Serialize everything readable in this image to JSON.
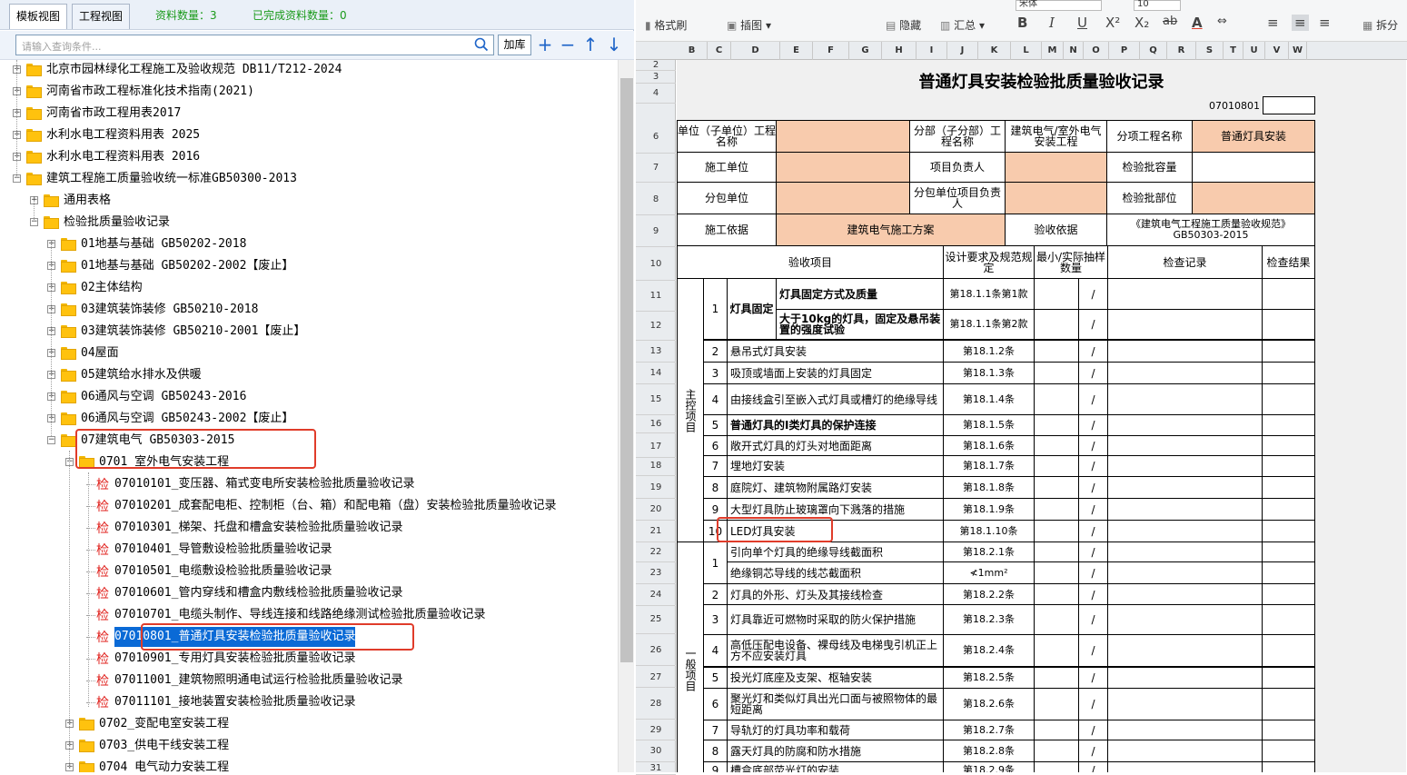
{
  "left_panel": {
    "tabs": [
      "模板视图",
      "工程视图"
    ],
    "counts": {
      "total": "资料数量：3",
      "done": "已完成资料数量：0"
    },
    "search": {
      "placeholder": "请输入查询条件...",
      "load_button": "加库"
    },
    "controls": {
      "add": "+",
      "remove": "−",
      "up": "↑",
      "down": "↓"
    },
    "tree": [
      {
        "label": "北京市园林绿化工程施工及验收规范 DB11/T212-2024",
        "level": 0,
        "state": "collapsed",
        "kind": "folder"
      },
      {
        "label": "河南省市政工程标准化技术指南(2021)",
        "level": 0,
        "state": "collapsed",
        "kind": "folder"
      },
      {
        "label": "河南省市政工程用表2017",
        "level": 0,
        "state": "collapsed",
        "kind": "folder"
      },
      {
        "label": "水利水电工程资料用表 2025",
        "level": 0,
        "state": "collapsed",
        "kind": "folder"
      },
      {
        "label": "水利水电工程资料用表 2016",
        "level": 0,
        "state": "collapsed",
        "kind": "folder"
      },
      {
        "label": "建筑工程施工质量验收统一标准GB50300-2013",
        "level": 0,
        "state": "expanded",
        "kind": "folder"
      },
      {
        "label": "通用表格",
        "level": 1,
        "state": "collapsed",
        "kind": "folder"
      },
      {
        "label": "检验批质量验收记录",
        "level": 1,
        "state": "expanded",
        "kind": "folder"
      },
      {
        "label": "01地基与基础 GB50202-2018",
        "level": 2,
        "state": "collapsed",
        "kind": "folder"
      },
      {
        "label": "01地基与基础 GB50202-2002【废止】",
        "level": 2,
        "state": "collapsed",
        "kind": "folder"
      },
      {
        "label": "02主体结构",
        "level": 2,
        "state": "collapsed",
        "kind": "folder"
      },
      {
        "label": "03建筑装饰装修 GB50210-2018",
        "level": 2,
        "state": "collapsed",
        "kind": "folder"
      },
      {
        "label": "03建筑装饰装修 GB50210-2001【废止】",
        "level": 2,
        "state": "collapsed",
        "kind": "folder"
      },
      {
        "label": "04屋面",
        "level": 2,
        "state": "collapsed",
        "kind": "folder"
      },
      {
        "label": "05建筑给水排水及供暖",
        "level": 2,
        "state": "collapsed",
        "kind": "folder"
      },
      {
        "label": "06通风与空调 GB50243-2016",
        "level": 2,
        "state": "collapsed",
        "kind": "folder"
      },
      {
        "label": "06通风与空调 GB50243-2002【废止】",
        "level": 2,
        "state": "collapsed",
        "kind": "folder"
      },
      {
        "label": "07建筑电气 GB50303-2015",
        "level": 2,
        "state": "expanded",
        "kind": "folder"
      },
      {
        "label": "0701 室外电气安装工程",
        "level": 3,
        "state": "expanded",
        "kind": "folder"
      },
      {
        "label": "07010101_变压器、箱式变电所安装检验批质量验收记录",
        "level": 4,
        "kind": "form"
      },
      {
        "label": "07010201_成套配电柜、控制柜（台、箱）和配电箱（盘）安装检验批质量验收记录",
        "level": 4,
        "kind": "form"
      },
      {
        "label": "07010301_梯架、托盘和槽盒安装检验批质量验收记录",
        "level": 4,
        "kind": "form"
      },
      {
        "label": "07010401_导管敷设检验批质量验收记录",
        "level": 4,
        "kind": "form"
      },
      {
        "label": "07010501_电缆敷设检验批质量验收记录",
        "level": 4,
        "kind": "form"
      },
      {
        "label": "07010601_管内穿线和槽盒内敷线检验批质量验收记录",
        "level": 4,
        "kind": "form"
      },
      {
        "label": "07010701_电缆头制作、导线连接和线路绝缘测试检验批质量验收记录",
        "level": 4,
        "kind": "form"
      },
      {
        "label": "07010801_普通灯具安装检验批质量验收记录",
        "level": 4,
        "kind": "form",
        "selected": true
      },
      {
        "label": "07010901_专用灯具安装检验批质量验收记录",
        "level": 4,
        "kind": "form"
      },
      {
        "label": "07011001_建筑物照明通电试运行检验批质量验收记录",
        "level": 4,
        "kind": "form"
      },
      {
        "label": "07011101_接地装置安装检验批质量验收记录",
        "level": 4,
        "kind": "form"
      },
      {
        "label": "0702_变配电室安装工程",
        "level": 3,
        "state": "collapsed",
        "kind": "folder"
      },
      {
        "label": "0703_供电干线安装工程",
        "level": 3,
        "state": "collapsed",
        "kind": "folder"
      },
      {
        "label": "0704_电气动力安装工程",
        "level": 3,
        "state": "collapsed",
        "kind": "folder"
      }
    ],
    "form_glyph": "检"
  },
  "toolbar": {
    "format_painter": "格式刷",
    "insert_chart": "插图",
    "hide": "隐藏",
    "summary": "汇总",
    "font_name": "宋体",
    "font_size": "10",
    "split": "拆分",
    "bold": "B",
    "italic": "I",
    "underline": "U",
    "sup": "X²",
    "sub": "X₂",
    "strike": "ab"
  },
  "columns": [
    "B",
    "C",
    "D",
    "E",
    "F",
    "G",
    "H",
    "I",
    "J",
    "K",
    "L",
    "M",
    "N",
    "O",
    "P",
    "Q",
    "R",
    "S",
    "T",
    "U",
    "V",
    "W"
  ],
  "rows": [
    "2",
    "3",
    "4",
    "6",
    "7",
    "8",
    "9",
    "10",
    "11",
    "12",
    "13",
    "14",
    "15",
    "16",
    "17",
    "18",
    "19",
    "20",
    "21",
    "22",
    "23",
    "24",
    "25",
    "26",
    "27",
    "28",
    "29",
    "30",
    "31"
  ],
  "form": {
    "title": "普通灯具安装检验批质量验收记录",
    "code": "07010801",
    "unit_label": "单位（子单位）工程名称",
    "subdiv_label": "分部（子分部）工程名称",
    "subdiv_value": "建筑电气/室外电气安装工程",
    "item_label": "分项工程名称",
    "item_value": "普通灯具安装",
    "contractor_label": "施工单位",
    "pm_label": "项目负责人",
    "capacity_label": "检验批容量",
    "sub_label": "分包单位",
    "sub_pm_label": "分包单位项目负责人",
    "location_label": "检验批部位",
    "basis_label": "施工依据",
    "basis_value": "建筑电气施工方案",
    "accept_label": "验收依据",
    "accept_value": "《建筑电气工程施工质量验收规范》GB50303-2015",
    "hdr_item": "验收项目",
    "hdr_design": "设计要求及规范规定",
    "hdr_sample": "最小/实际抽样数量",
    "hdr_record": "检查记录",
    "hdr_result": "检查结果",
    "main_label": "主控项目",
    "general_label": "一般项目",
    "main_items": [
      {
        "no": "1",
        "group": "灯具固定",
        "text": "灯具固定方式及质量",
        "clause": "第18.1.1条第1款",
        "bold": true
      },
      {
        "no": "",
        "group": "",
        "text": "大于10kg的灯具，固定及悬吊装置的强度试验",
        "clause": "第18.1.1条第2款",
        "bold": true
      },
      {
        "no": "2",
        "text": "悬吊式灯具安装",
        "clause": "第18.1.2条"
      },
      {
        "no": "3",
        "text": "吸顶或墙面上安装的灯具固定",
        "clause": "第18.1.3条"
      },
      {
        "no": "4",
        "text": "由接线盒引至嵌入式灯具或槽灯的绝缘导线",
        "clause": "第18.1.4条"
      },
      {
        "no": "5",
        "text": "普通灯具的I类灯具的保护连接",
        "clause": "第18.1.5条",
        "bold": true
      },
      {
        "no": "6",
        "text": "敞开式灯具的灯头对地面距离",
        "clause": "第18.1.6条"
      },
      {
        "no": "7",
        "text": "埋地灯安装",
        "clause": "第18.1.7条"
      },
      {
        "no": "8",
        "text": "庭院灯、建筑物附属路灯安装",
        "clause": "第18.1.8条"
      },
      {
        "no": "9",
        "text": "大型灯具防止玻璃罩向下溅落的措施",
        "clause": "第18.1.9条"
      },
      {
        "no": "10",
        "text": "LED灯具安装",
        "clause": "第18.1.10条"
      }
    ],
    "general_items": [
      {
        "no": "1",
        "text": "引向单个灯具的绝缘导线截面积",
        "clause": "第18.2.1条"
      },
      {
        "no": "",
        "text": "绝缘铜芯导线的线芯截面积",
        "clause": "≮1mm²"
      },
      {
        "no": "2",
        "text": "灯具的外形、灯头及其接线检查",
        "clause": "第18.2.2条"
      },
      {
        "no": "3",
        "text": "灯具靠近可燃物时采取的防火保护措施",
        "clause": "第18.2.3条"
      },
      {
        "no": "4",
        "text": "高低压配电设备、裸母线及电梯曳引机正上方不应安装灯具",
        "clause": "第18.2.4条"
      },
      {
        "no": "5",
        "text": "投光灯底座及支架、枢轴安装",
        "clause": "第18.2.5条"
      },
      {
        "no": "6",
        "text": "聚光灯和类似灯具出光口面与被照物体的最短距离",
        "clause": "第18.2.6条"
      },
      {
        "no": "7",
        "text": "导轨灯的灯具功率和载荷",
        "clause": "第18.2.7条"
      },
      {
        "no": "8",
        "text": "露天灯具的防腐和防水措施",
        "clause": "第18.2.8条"
      },
      {
        "no": "9",
        "text": "槽盒底部荧光灯的安装",
        "clause": "第18.2.9条"
      }
    ],
    "slash": "/"
  }
}
